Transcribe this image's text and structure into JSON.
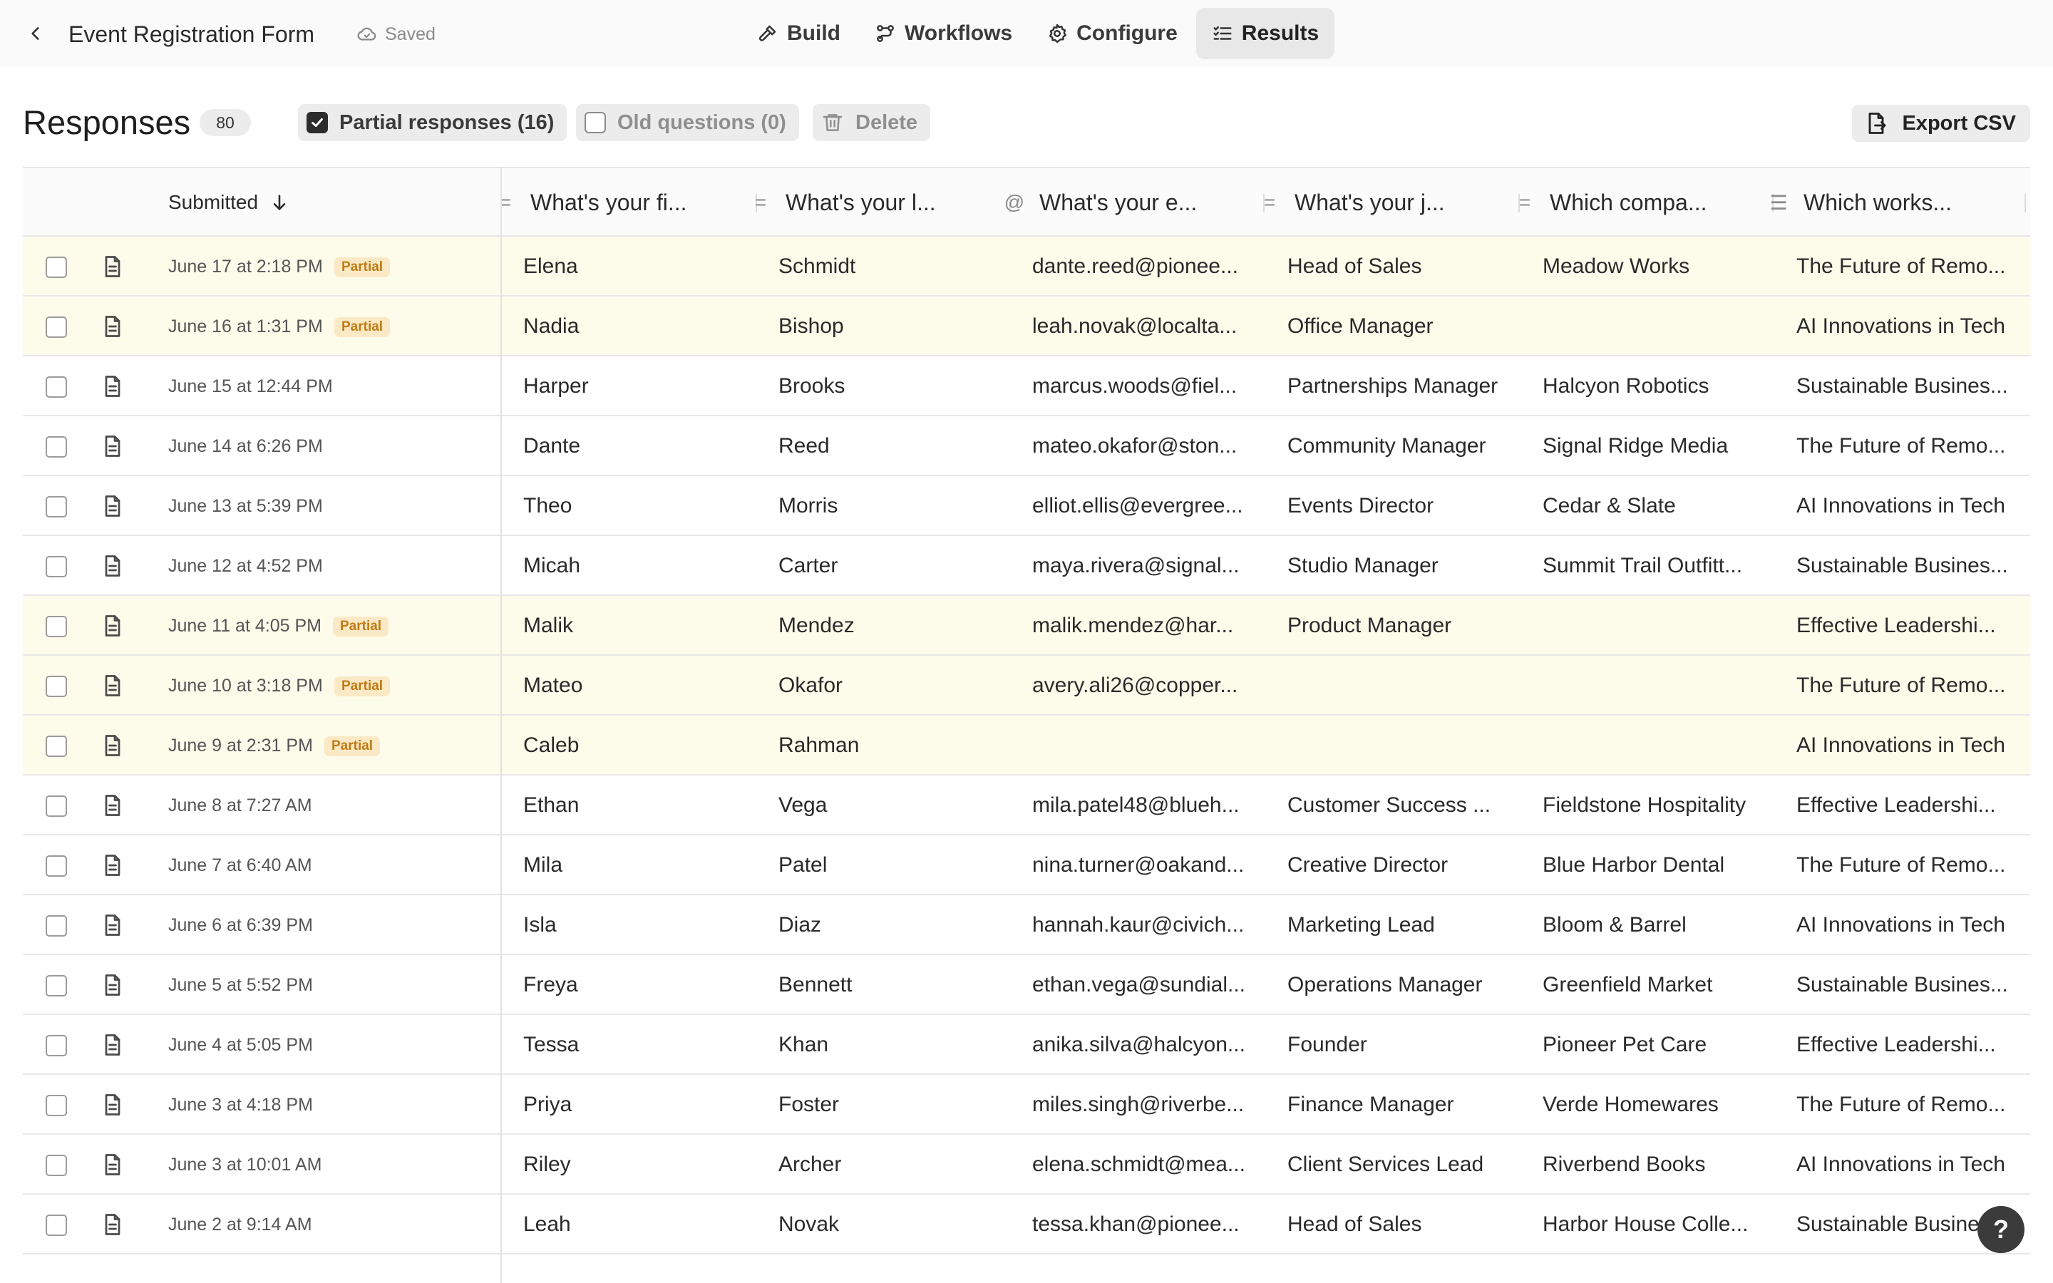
{
  "header": {
    "form_title": "Event Registration Form",
    "saved_label": "Saved",
    "tabs": [
      {
        "label": "Build",
        "icon": "hammer-icon"
      },
      {
        "label": "Workflows",
        "icon": "workflow-icon"
      },
      {
        "label": "Configure",
        "icon": "gear-icon"
      },
      {
        "label": "Results",
        "icon": "list-check-icon",
        "active": true
      }
    ]
  },
  "toolbar": {
    "title": "Responses",
    "count": "80",
    "partial_label": "Partial responses (16)",
    "partial_checked": true,
    "old_label": "Old questions (0)",
    "old_checked": false,
    "delete_label": "Delete",
    "export_label": "Export CSV"
  },
  "table": {
    "submitted_header": "Submitted",
    "sort": "descending",
    "partial_badge": "Partial",
    "columns": [
      {
        "label": "What's your fi...",
        "icon": "short-text-icon"
      },
      {
        "label": "What's your l...",
        "icon": "short-text-icon"
      },
      {
        "label": "What's your e...",
        "icon": "at-sign-icon"
      },
      {
        "label": "What's your j...",
        "icon": "short-text-icon"
      },
      {
        "label": "Which compa...",
        "icon": "short-text-icon"
      },
      {
        "label": "Which works...",
        "icon": "checklist-icon"
      }
    ],
    "rows": [
      {
        "date": "June 17 at 2:18 PM",
        "partial": true,
        "first": "Elena",
        "last": "Schmidt",
        "email": "dante.reed@pionee...",
        "job": "Head of Sales",
        "company": "Meadow Works",
        "workshop": "The Future of Remo..."
      },
      {
        "date": "June 16 at 1:31 PM",
        "partial": true,
        "first": "Nadia",
        "last": "Bishop",
        "email": "leah.novak@localta...",
        "job": "Office Manager",
        "company": "",
        "workshop": "AI Innovations in Tech"
      },
      {
        "date": "June 15 at 12:44 PM",
        "partial": false,
        "first": "Harper",
        "last": "Brooks",
        "email": "marcus.woods@fiel...",
        "job": "Partnerships Manager",
        "company": "Halcyon Robotics",
        "workshop": "Sustainable Busines..."
      },
      {
        "date": "June 14 at 6:26 PM",
        "partial": false,
        "first": "Dante",
        "last": "Reed",
        "email": "mateo.okafor@ston...",
        "job": "Community Manager",
        "company": "Signal Ridge Media",
        "workshop": "The Future of Remo..."
      },
      {
        "date": "June 13 at 5:39 PM",
        "partial": false,
        "first": "Theo",
        "last": "Morris",
        "email": "elliot.ellis@evergree...",
        "job": "Events Director",
        "company": "Cedar & Slate",
        "workshop": "AI Innovations in Tech"
      },
      {
        "date": "June 12 at 4:52 PM",
        "partial": false,
        "first": "Micah",
        "last": "Carter",
        "email": "maya.rivera@signal...",
        "job": "Studio Manager",
        "company": "Summit Trail Outfitt...",
        "workshop": "Sustainable Busines..."
      },
      {
        "date": "June 11 at 4:05 PM",
        "partial": true,
        "first": "Malik",
        "last": "Mendez",
        "email": "malik.mendez@har...",
        "job": "Product Manager",
        "company": "",
        "workshop": "Effective Leadershi..."
      },
      {
        "date": "June 10 at 3:18 PM",
        "partial": true,
        "first": "Mateo",
        "last": "Okafor",
        "email": "avery.ali26@copper...",
        "job": "",
        "company": "",
        "workshop": "The Future of Remo..."
      },
      {
        "date": "June 9 at 2:31 PM",
        "partial": true,
        "first": "Caleb",
        "last": "Rahman",
        "email": "",
        "job": "",
        "company": "",
        "workshop": "AI Innovations in Tech"
      },
      {
        "date": "June 8 at 7:27 AM",
        "partial": false,
        "first": "Ethan",
        "last": "Vega",
        "email": "mila.patel48@blueh...",
        "job": "Customer Success ...",
        "company": "Fieldstone Hospitality",
        "workshop": "Effective Leadershi..."
      },
      {
        "date": "June 7 at 6:40 AM",
        "partial": false,
        "first": "Mila",
        "last": "Patel",
        "email": "nina.turner@oakand...",
        "job": "Creative Director",
        "company": "Blue Harbor Dental",
        "workshop": "The Future of Remo..."
      },
      {
        "date": "June 6 at 6:39 PM",
        "partial": false,
        "first": "Isla",
        "last": "Diaz",
        "email": "hannah.kaur@civich...",
        "job": "Marketing Lead",
        "company": "Bloom & Barrel",
        "workshop": "AI Innovations in Tech"
      },
      {
        "date": "June 5 at 5:52 PM",
        "partial": false,
        "first": "Freya",
        "last": "Bennett",
        "email": "ethan.vega@sundial...",
        "job": "Operations Manager",
        "company": "Greenfield Market",
        "workshop": "Sustainable Busines..."
      },
      {
        "date": "June 4 at 5:05 PM",
        "partial": false,
        "first": "Tessa",
        "last": "Khan",
        "email": "anika.silva@halcyon...",
        "job": "Founder",
        "company": "Pioneer Pet Care",
        "workshop": "Effective Leadershi..."
      },
      {
        "date": "June 3 at 4:18 PM",
        "partial": false,
        "first": "Priya",
        "last": "Foster",
        "email": "miles.singh@riverbe...",
        "job": "Finance Manager",
        "company": "Verde Homewares",
        "workshop": "The Future of Remo..."
      },
      {
        "date": "June 3 at 10:01 AM",
        "partial": false,
        "first": "Riley",
        "last": "Archer",
        "email": "elena.schmidt@mea...",
        "job": "Client Services Lead",
        "company": "Riverbend Books",
        "workshop": "AI Innovations in Tech"
      },
      {
        "date": "June 2 at 9:14 AM",
        "partial": false,
        "first": "Leah",
        "last": "Novak",
        "email": "tessa.khan@pionee...",
        "job": "Head of Sales",
        "company": "Harbor House Colle...",
        "workshop": "Sustainable Busine..."
      }
    ]
  },
  "help_label": "?"
}
